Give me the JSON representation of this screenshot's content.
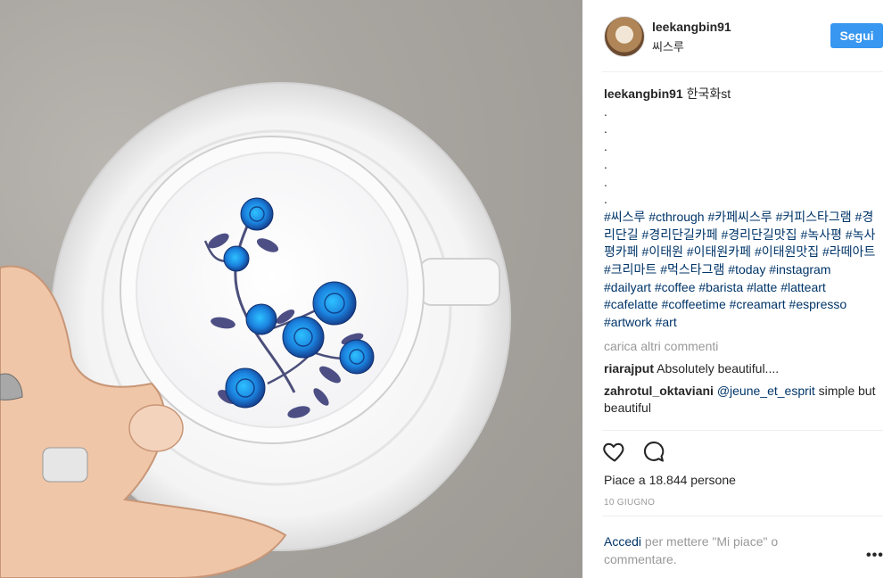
{
  "post": {
    "username": "leekangbin91",
    "location": "씨스루",
    "follow_label": "Segui"
  },
  "caption": {
    "username": "leekangbin91",
    "text": "한국화st",
    "dots": [
      ".",
      ".",
      ".",
      ".",
      ".",
      "."
    ],
    "hashtags": [
      "#씨스루",
      "#cthrough",
      "#카페씨스루",
      "#커피스타그램",
      "#경리단길",
      "#경리단길카페",
      "#경리단길맛집",
      "#녹사평",
      "#녹사평카페",
      "#이태원",
      "#이태원카페",
      "#이태원맛집",
      "#라떼아트",
      "#크리마트",
      "#먹스타그램",
      "#today",
      "#instagram",
      "#dailyart",
      "#coffee",
      "#barista",
      "#latte",
      "#latteart",
      "#cafelatte",
      "#coffeetime",
      "#creamart",
      "#espresso",
      "#artwork",
      "#art"
    ]
  },
  "load_more": "carica altri commenti",
  "comments": [
    {
      "user": "riarajput",
      "mention": "",
      "text": "Absolutely beautiful...."
    },
    {
      "user": "zahrotul_oktaviani",
      "mention": "@jeune_et_esprit",
      "text": "simple but beautiful"
    }
  ],
  "actions": {
    "like_icon": "heart-icon",
    "comment_icon": "comment-icon"
  },
  "likes_text": "Piace a 18.844 persone",
  "date": "10 GIUGNO",
  "login": {
    "link": "Accedi",
    "text": "per mettere \"Mi piace\" o commentare."
  },
  "more_options": "•••",
  "colors": {
    "follow_bg": "#3897f0",
    "link": "#003569",
    "muted": "#999999",
    "rose_blue": "#1e8fe8"
  }
}
